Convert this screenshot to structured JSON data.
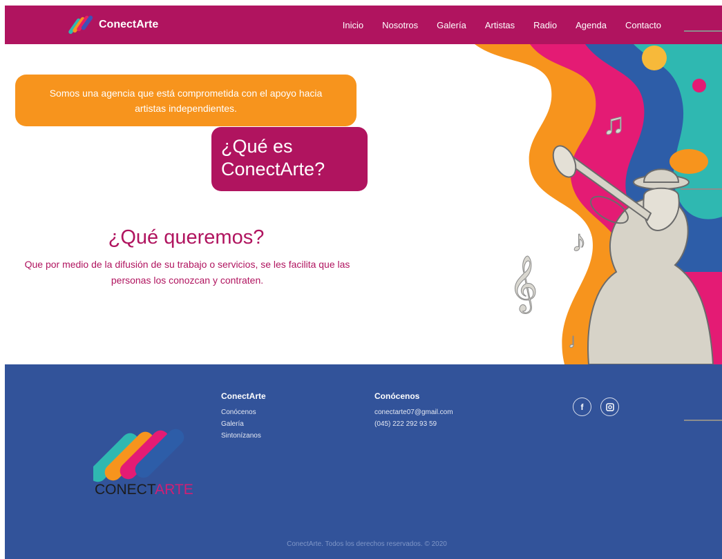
{
  "header": {
    "brand": "ConectArte",
    "menu": [
      "Inicio",
      "Nosotros",
      "Galería",
      "Artistas",
      "Radio",
      "Agenda",
      "Contacto"
    ]
  },
  "hero": {
    "intro": "Somos una agencia que está comprometida con el apoyo hacia artistas independientes.",
    "question": "¿Qué es ConectArte?",
    "want_title": "¿Qué queremos?",
    "want_text": "Que por medio  de la difusión de su trabajo o servicios, se les facilita que las personas los conozcan y contraten."
  },
  "footer": {
    "wordmark_prefix": "CONECT",
    "wordmark_suffix": "ARTE",
    "col1": {
      "title": "ConectArte",
      "links": [
        "Conócenos",
        "Galería",
        "Sintonízanos"
      ]
    },
    "col2": {
      "title": "Conócenos",
      "email": "conectarte07@gmail.com",
      "phone": "(045) 222 292 93 59"
    },
    "social": [
      "facebook-icon",
      "instagram-icon"
    ],
    "copyright": "ConectArte. Todos los derechos reservados. © 2020"
  },
  "colors": {
    "magenta": "#b0145f",
    "orange": "#f7941d",
    "footer_blue": "#32539a",
    "teal": "#2fb8b1"
  }
}
